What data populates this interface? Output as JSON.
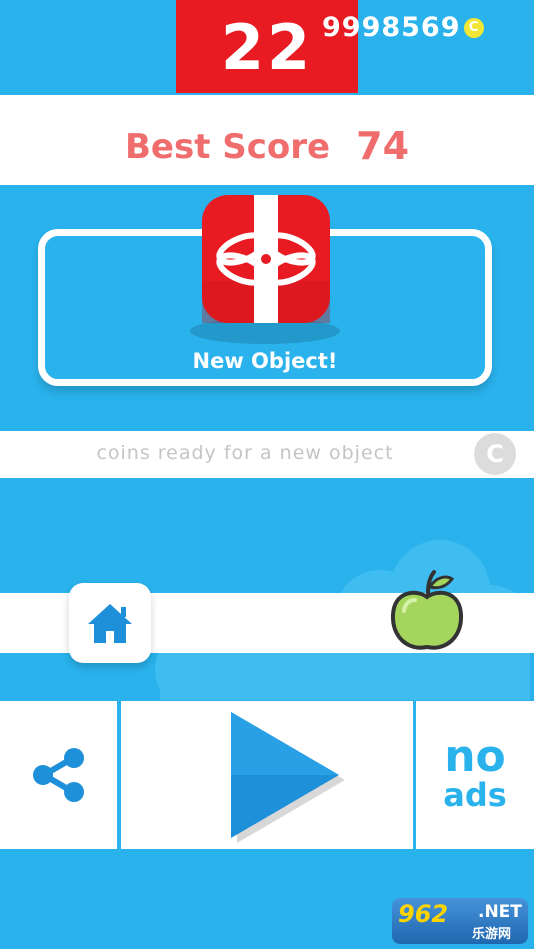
{
  "top": {
    "score": "22",
    "coins": "9998569",
    "coin_symbol": "C"
  },
  "best": {
    "label": "Best Score",
    "value": "74"
  },
  "new_object": {
    "label": "New Object!"
  },
  "ready": {
    "text": "coins ready for a new object",
    "coin_symbol": "C"
  },
  "buttons": {
    "no": "no",
    "ads": "ads"
  },
  "watermark": {
    "main": "962",
    "suffix": ".NET",
    "cn": "乐游网"
  },
  "colors": {
    "background": "#29b2ec",
    "score_red": "#e81b23",
    "best_score_text": "#ef6d6d",
    "coin_yellow": "#f2e637",
    "apple_green": "#a4d65e"
  },
  "icons": {
    "gift": "gift-box-icon",
    "home": "home-icon",
    "share": "share-icon",
    "play": "play-icon",
    "apple": "apple-icon"
  }
}
